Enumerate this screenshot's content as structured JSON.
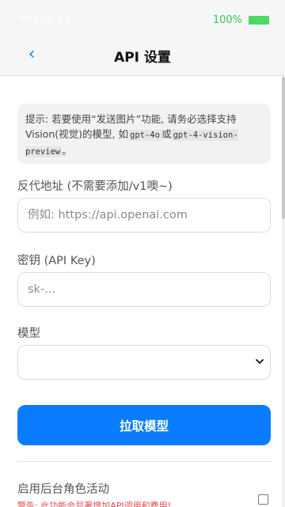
{
  "status_bar": {
    "time": "下午05:20",
    "battery_percent": "100%",
    "battery_level": 1.0,
    "battery_color": "#4cd964"
  },
  "header": {
    "back_icon": "chevron-left-icon",
    "back_glyph": "‹",
    "title": "API 设置"
  },
  "notice": {
    "text_before": "提示: 若要使用“发送图片”功能, 请务必选择支持Vision(视觉)的模型, 如",
    "code_1": "gpt-4o",
    "text_middle": "或",
    "code_2": "gpt-4-vision-preview",
    "text_after": "。"
  },
  "form": {
    "proxy_label": "反代地址 (不需要添加/v1噢~)",
    "proxy_placeholder": "例如: https://api.openai.com",
    "proxy_value": "",
    "key_label": "密钥 (API Key)",
    "key_placeholder": "sk-...",
    "key_value": "",
    "model_label": "模型",
    "model_selected": ""
  },
  "actions": {
    "fetch_models_label": "拉取模型"
  },
  "background_activity": {
    "label": "启用后台角色活动",
    "warning": "警告: 此功能会显著增加API调用和费用!",
    "enabled": false
  },
  "colors": {
    "accent": "#0a7cff",
    "warning": "#e5484d",
    "battery": "#34c759"
  }
}
